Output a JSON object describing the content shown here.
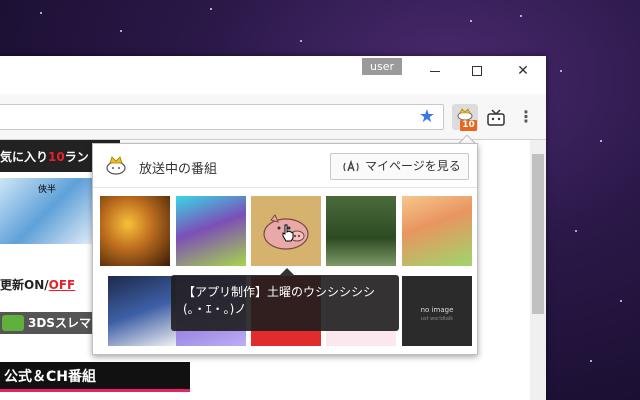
{
  "window": {
    "user_label": "user"
  },
  "toolbar": {
    "extension_badge": "10"
  },
  "page": {
    "nav_prefix": "気に入り",
    "nav_count": "10",
    "nav_suffix": "ラン",
    "thumb_name": "俠半",
    "update_prefix": "更新",
    "update_on": "ON",
    "update_sep": "/",
    "update_off": "OFF",
    "ds_label": "3DSスレマ",
    "koushiki_label": "公式＆CH番組"
  },
  "popup": {
    "title": "放送中の番組",
    "mypage_label": "マイページを見る",
    "thumbnails": [
      {
        "id": "t1"
      },
      {
        "id": "t2"
      },
      {
        "id": "t3"
      },
      {
        "id": "t4"
      },
      {
        "id": "t5"
      },
      {
        "id": "t6"
      },
      {
        "id": "t7"
      },
      {
        "id": "t8"
      },
      {
        "id": "t9"
      },
      {
        "id": "t10",
        "label": "no image",
        "sublabel": "ust worldtalk"
      }
    ],
    "tooltip_line1": "【アプリ制作】土曜のウシシシシシ",
    "tooltip_line2": "(｡・ｴ・｡)ノ"
  },
  "colors": {
    "accent_orange": "#e8661e",
    "accent_red": "#e8202a",
    "accent_pink": "#e8206a",
    "star_blue": "#3b78e7"
  }
}
